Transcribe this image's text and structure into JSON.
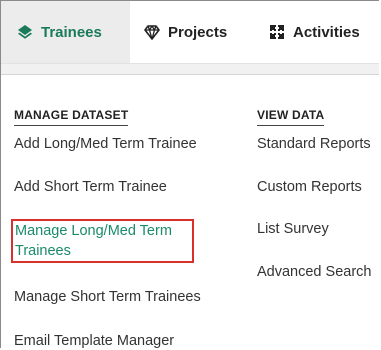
{
  "nav": {
    "tabs": [
      {
        "label": "Trainees",
        "icon": "diamond-stack-icon",
        "active": true
      },
      {
        "label": "Projects",
        "icon": "gem-icon",
        "active": false
      },
      {
        "label": "Activities",
        "icon": "puzzle-icon",
        "active": false
      }
    ]
  },
  "colors": {
    "accent": "#1a7a5a",
    "highlight_border": "#d9302c",
    "active_tab_bg": "#ececec"
  },
  "manage_dataset": {
    "header": "MANAGE DATASET",
    "items": [
      "Add Long/Med Term Trainee",
      "Add Short Term Trainee",
      "Manage Long/Med Term Trainees",
      "Manage Short Term Trainees",
      "Email Template Manager"
    ]
  },
  "view_data": {
    "header": "VIEW DATA",
    "items": [
      "Standard Reports",
      "Custom Reports",
      "List Survey",
      "Advanced Search"
    ]
  }
}
